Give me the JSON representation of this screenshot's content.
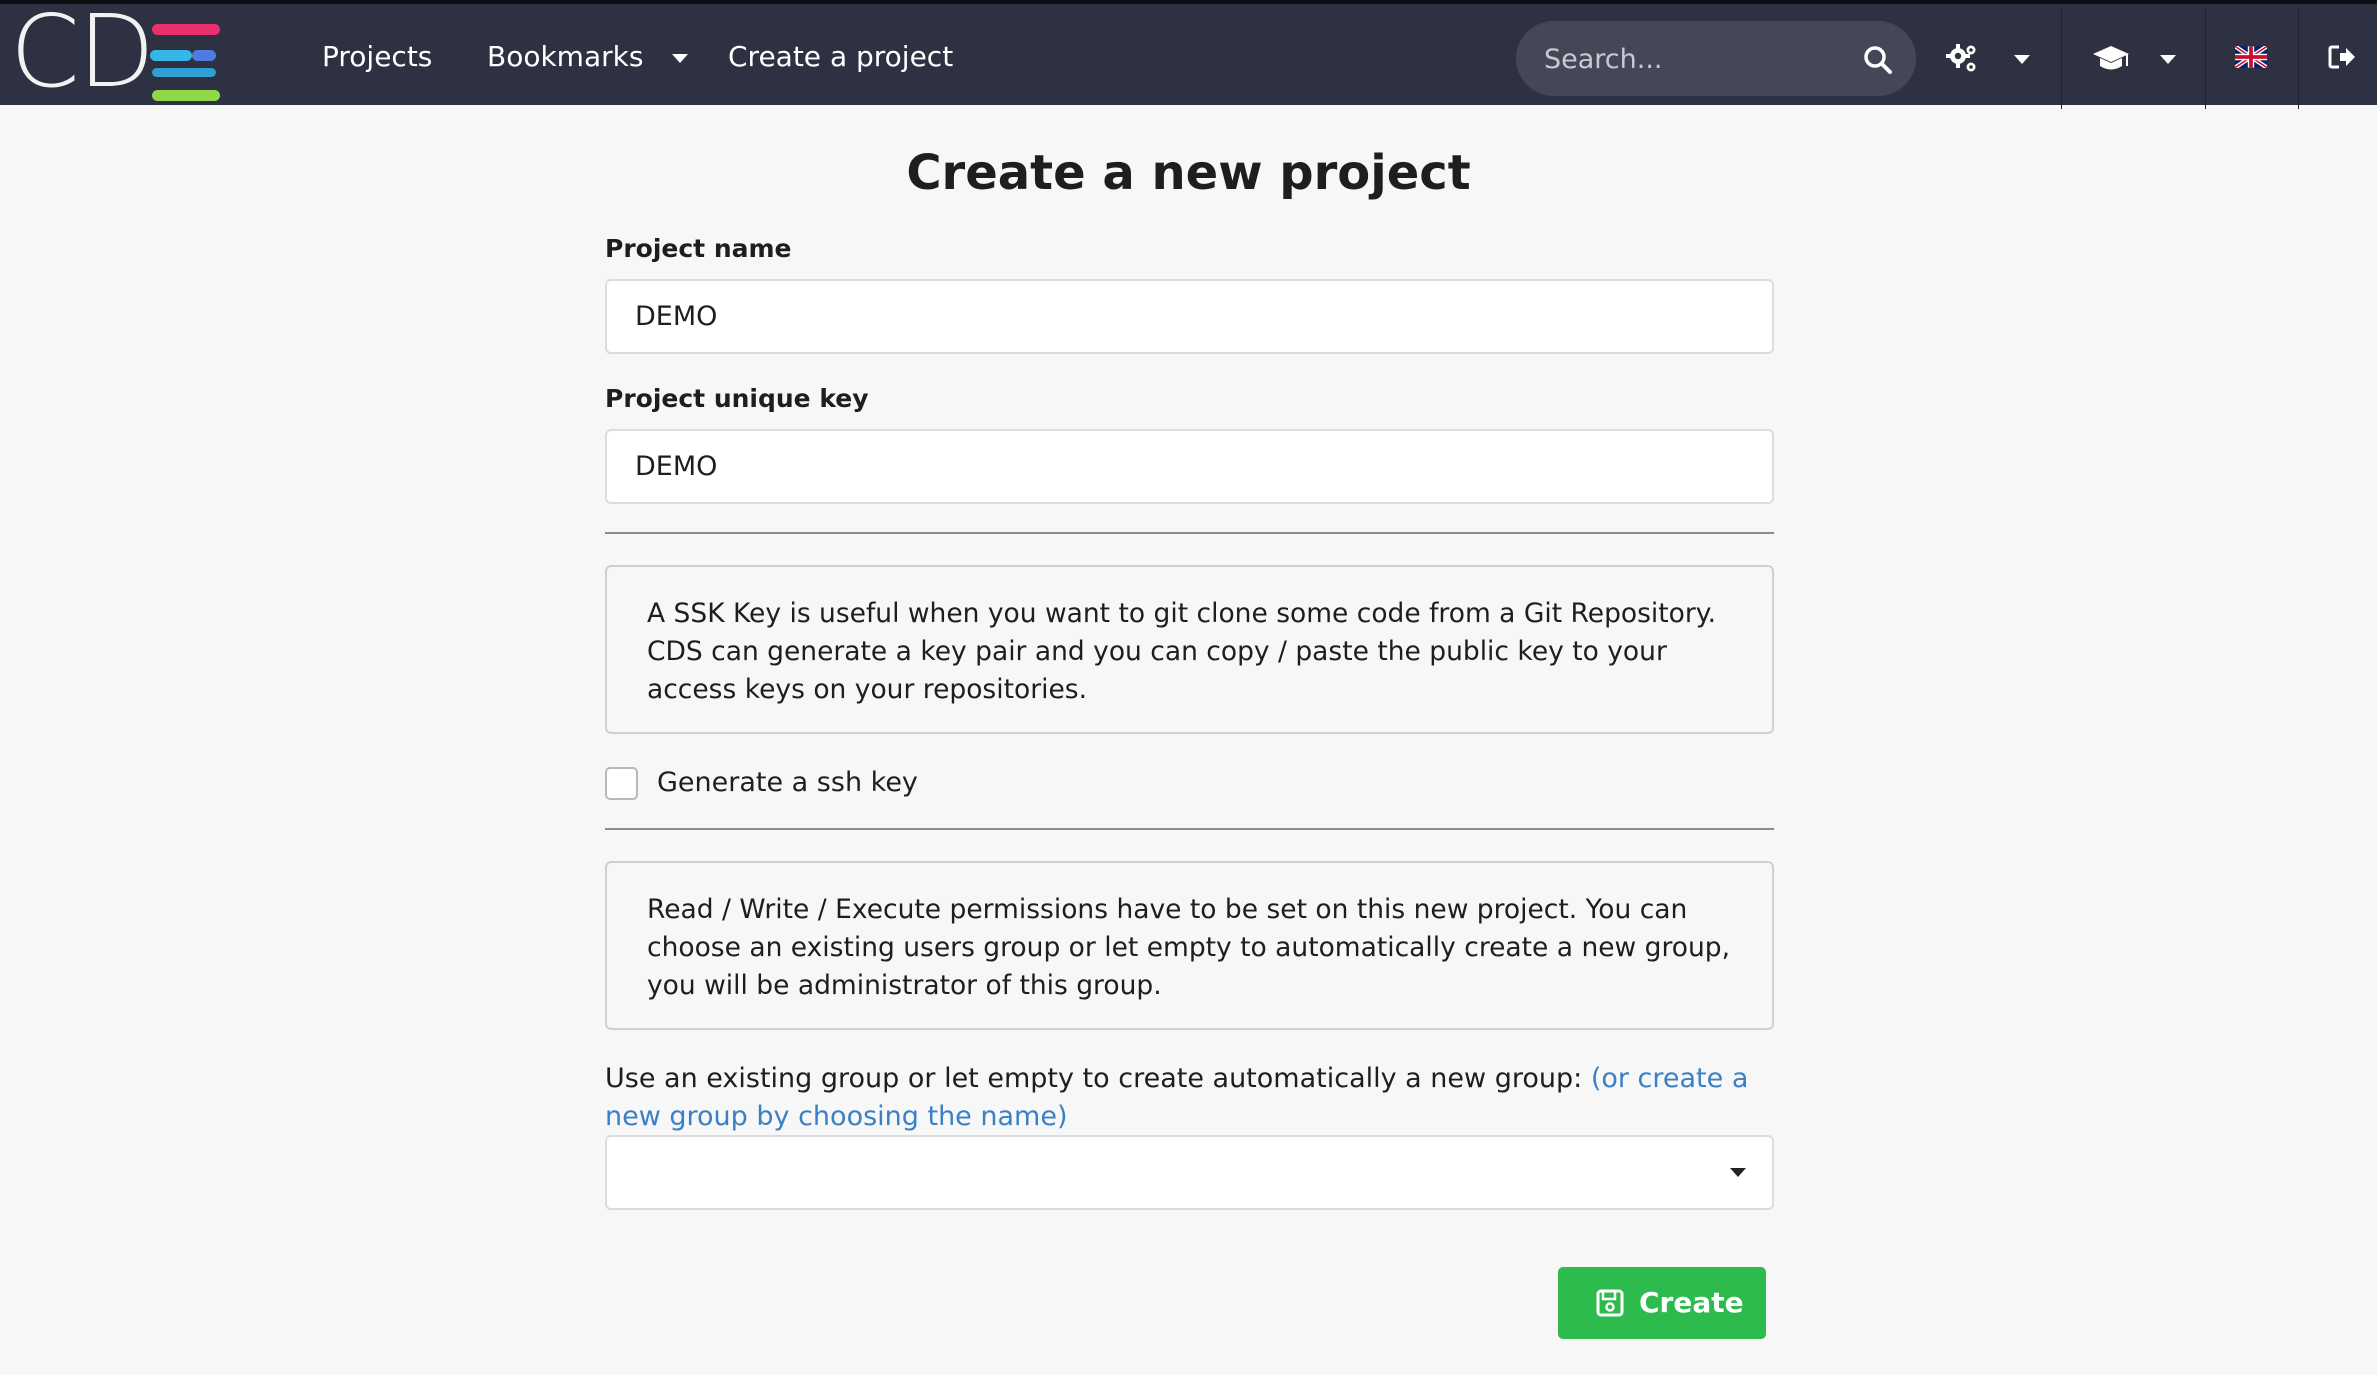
{
  "navbar": {
    "logo_text": "CD",
    "links": [
      {
        "label": "Projects"
      },
      {
        "label": "Bookmarks"
      },
      {
        "label": "Create a project"
      }
    ],
    "search_placeholder": "Search...",
    "icons": [
      "search-icon",
      "settings-cogs-icon",
      "graduation-cap-icon",
      "uk-flag-icon",
      "sign-out-icon"
    ],
    "colors": {
      "background": "#2d3142",
      "search_bg": "#434757"
    }
  },
  "main": {
    "title": "Create a new project",
    "project_name": {
      "label": "Project name",
      "value": "DEMO"
    },
    "project_key": {
      "label": "Project unique key",
      "value": "DEMO"
    },
    "ssh_info": "A SSK Key is useful when you want to git clone some code from a Git Repository. CDS can generate a key pair and you can copy / paste the public key to your access keys on your repositories.",
    "ssh_checkbox": {
      "label": "Generate a ssh key",
      "checked": false
    },
    "permissions_info": "Read / Write / Execute permissions have to be set on this new project. You can choose an existing users group or let empty to automatically create a new group, you will be administrator of this group.",
    "group": {
      "label": "Use an existing group or let empty to create automatically a new group:",
      "link": "(or create a new group by choosing the name)",
      "selected": ""
    },
    "create_button": {
      "label": "Create",
      "icon": "save-icon",
      "color": "#2dbb4d"
    }
  }
}
